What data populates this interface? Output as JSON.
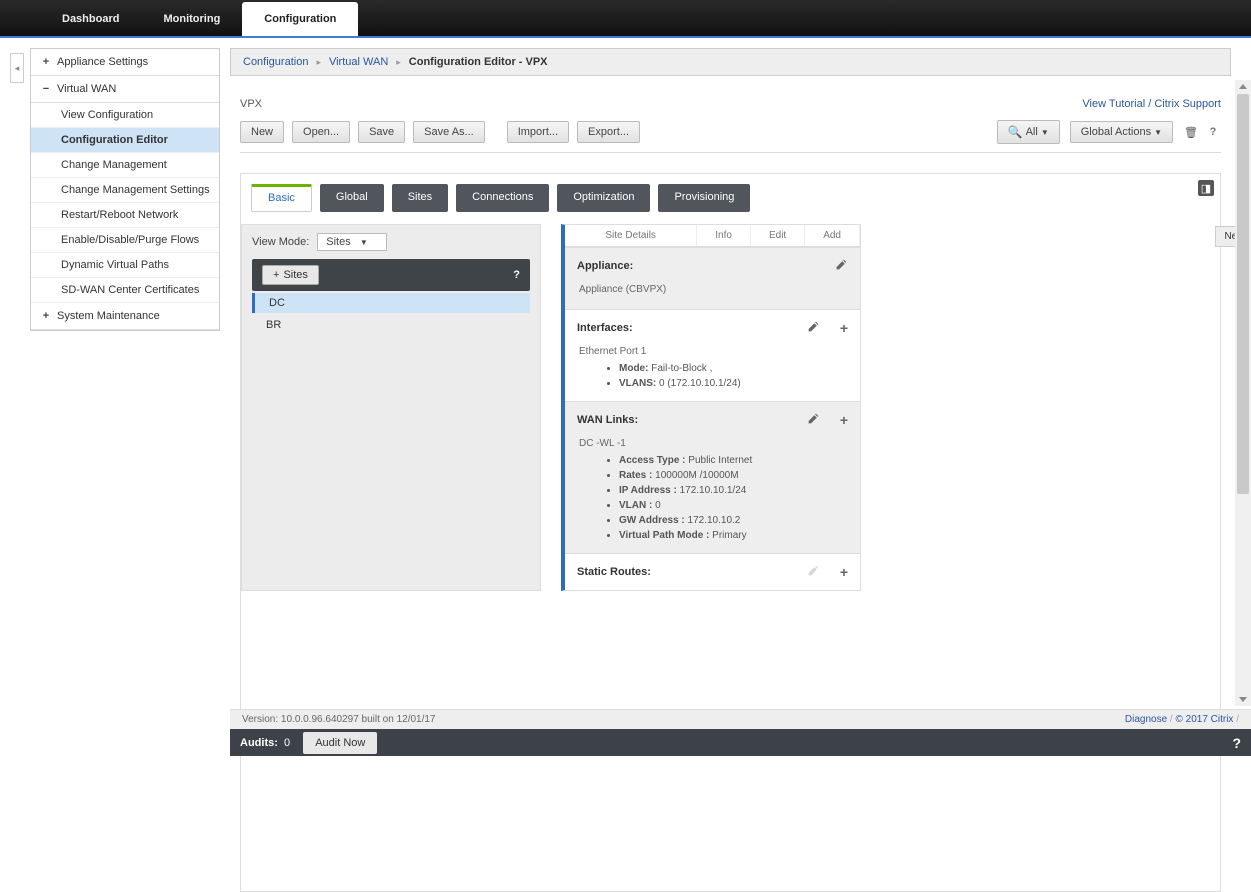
{
  "topnav": {
    "tabs": [
      "Dashboard",
      "Monitoring",
      "Configuration"
    ],
    "active": 2
  },
  "sidebar": {
    "appliance_settings": "Appliance Settings",
    "virtual_wan": "Virtual WAN",
    "vwan_items": [
      "View Configuration",
      "Configuration Editor",
      "Change Management",
      "Change Management Settings",
      "Restart/Reboot Network",
      "Enable/Disable/Purge Flows",
      "Dynamic Virtual Paths",
      "SD-WAN Center Certificates"
    ],
    "system_maintenance": "System Maintenance"
  },
  "breadcrumb": {
    "a": "Configuration",
    "b": "Virtual WAN",
    "c": "Configuration Editor - VPX"
  },
  "page_title": "VPX",
  "links": {
    "tutorial": "View Tutorial",
    "support": "Citrix Support"
  },
  "toolbar": {
    "new": "New",
    "open": "Open...",
    "save": "Save",
    "saveas": "Save As...",
    "import": "Import...",
    "export": "Export...",
    "search_all": "All",
    "global_actions": "Global Actions"
  },
  "cfg_tabs": [
    "Basic",
    "Global",
    "Sites",
    "Connections",
    "Optimization",
    "Provisioning"
  ],
  "view_mode": {
    "label": "View Mode:",
    "value": "Sites"
  },
  "sites_button": "Sites",
  "site_list": [
    "DC",
    "BR"
  ],
  "detail_tabs": {
    "site_details": "Site Details",
    "info": "Info",
    "edit": "Edit",
    "add": "Add"
  },
  "appliance": {
    "header": "Appliance:",
    "value": "Appliance (CBVPX)"
  },
  "interfaces": {
    "header": "Interfaces:",
    "port": "Ethernet Port 1",
    "mode_label": "Mode:",
    "mode_value": "Fail-to-Block ,",
    "vlans_label": "VLANS:",
    "vlans_value": "0 (172.10.10.1/24)"
  },
  "wan": {
    "header": "WAN Links:",
    "name": "DC -WL -1",
    "rows": [
      {
        "k": "Access Type :",
        "v": "Public Internet"
      },
      {
        "k": "Rates :",
        "v": "100000M /10000M"
      },
      {
        "k": "IP Address :",
        "v": "172.10.10.1/24"
      },
      {
        "k": "VLAN :",
        "v": "0"
      },
      {
        "k": "GW Address :",
        "v": "172.10.10.2"
      },
      {
        "k": "Virtual Path Mode :",
        "v": "Primary"
      }
    ]
  },
  "static_routes": {
    "header": "Static Routes:"
  },
  "float_tab": "Net",
  "footer": {
    "version": "Version: 10.0.0.96.640297 built on 12/01/17",
    "diagnose": "Diagnose",
    "copyright": "© 2017 Citrix",
    "audits_label": "Audits:",
    "audits_count": "0",
    "audit_now": "Audit Now"
  },
  "help_q": "?"
}
